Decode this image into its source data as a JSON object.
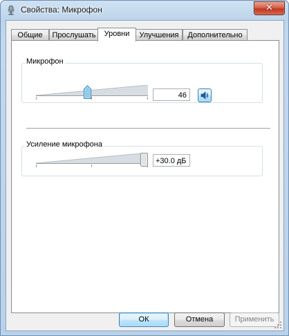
{
  "window": {
    "title": "Свойства: Микрофон",
    "close_glyph": "✕",
    "app_icon": "microphone-icon"
  },
  "tabs": [
    {
      "label": "Общие",
      "active": false
    },
    {
      "label": "Прослушать",
      "active": false
    },
    {
      "label": "Уровни",
      "active": true
    },
    {
      "label": "Улучшения",
      "active": false
    },
    {
      "label": "Дополнительно",
      "active": false
    }
  ],
  "microphone_level": {
    "label": "Микрофон",
    "value": "46",
    "level": 46,
    "max": 100,
    "speaker_icon": "speaker-icon"
  },
  "mic_boost": {
    "label": "Усиление микрофона",
    "value": "+30.0 дБ",
    "level_db": 30,
    "max_db": 30
  },
  "buttons": {
    "ok": "ОК",
    "cancel": "Отмена",
    "apply": "Применить"
  },
  "colors": {
    "default_button_border": "#3c7fb1",
    "close_button": "#c0391f",
    "frame": "#bcd4ea"
  }
}
